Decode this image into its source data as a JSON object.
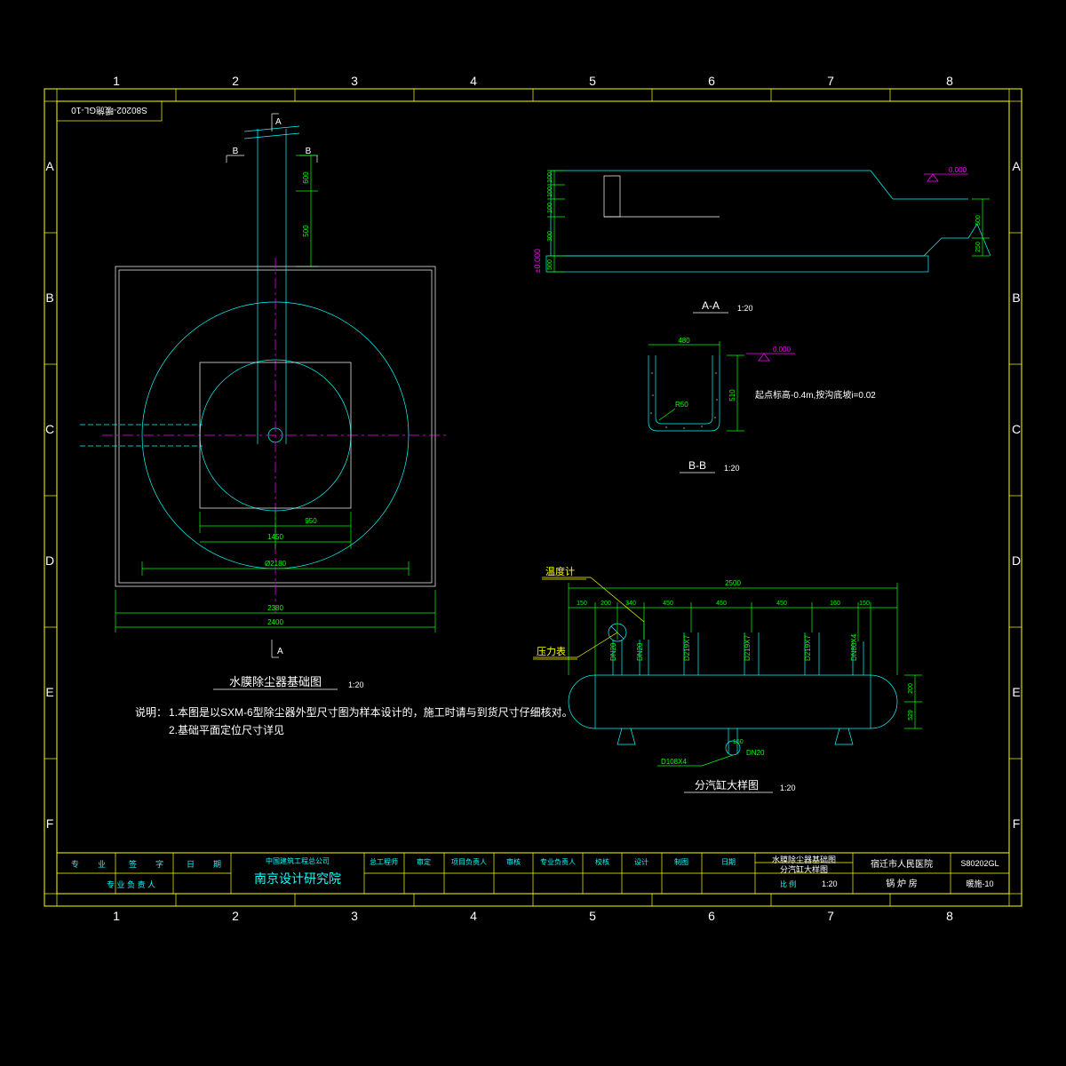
{
  "frame": {
    "drawing_id_top": "S80202-暖施GL-10",
    "cols": [
      "1",
      "2",
      "3",
      "4",
      "5",
      "6",
      "7",
      "8"
    ],
    "rows": [
      "A",
      "B",
      "C",
      "D",
      "E",
      "F"
    ]
  },
  "plan": {
    "title": "水膜除尘器基础图",
    "scale": "1:20",
    "section_labels": {
      "a": "A",
      "b": "B"
    },
    "dims": {
      "d1": "600",
      "d2": "500",
      "inner": "950",
      "mid": "1450",
      "ring": "Ø2180",
      "outer": "2380",
      "outer2": "2400"
    }
  },
  "notes": {
    "prefix": "说明：",
    "l1": "1.本图是以SXM-6型除尘器外型尺寸图为样本设计的，施工时请与到货尺寸仔细核对。",
    "l2": "2.基础平面定位尺寸详见"
  },
  "section_a": {
    "title": "A-A",
    "scale": "1:20",
    "elev0": "0.000",
    "datum": "±0.000",
    "dims": {
      "t1": "100",
      "t2": "100",
      "t3": "100",
      "t4": "300",
      "t5": "500",
      "right1": "500",
      "right2": "250"
    }
  },
  "section_b": {
    "title": "B-B",
    "scale": "1:20",
    "elev": "0.000",
    "note": "起点标高-0.4m,按沟底坡i=0.02",
    "w": "480",
    "h": "510",
    "r": "R50"
  },
  "cylinder": {
    "title": "分汽缸大样图",
    "scale": "1:20",
    "labels": {
      "temp": "温度计",
      "press": "压力表"
    },
    "nozzles": [
      "DN20",
      "DN20",
      "D219X7",
      "D219X7",
      "D219X7",
      "DN80X4"
    ],
    "dims": {
      "total": "2500",
      "seg": [
        "150",
        "200",
        "340",
        "450",
        "450",
        "450",
        "160",
        "150"
      ],
      "h": "200",
      "drain": "D108X4",
      "dn": "DN20",
      "sl": "150",
      "end": "529"
    }
  },
  "titleblock": {
    "institute_small": "中国建筑工程总公司",
    "institute": "南京设计研究院",
    "roles": [
      "总工程师",
      "审定",
      "项目负责人",
      "审核",
      "专业负责人",
      "校核",
      "设计",
      "制图",
      "日期"
    ],
    "left_labels": [
      "专",
      "业",
      "签",
      "字",
      "日",
      "期"
    ],
    "left_row2": "专 业 负 责 人",
    "drawing_title1": "水膜除尘器基础图",
    "drawing_title2": "分汽缸大样图",
    "scale_label": "比 例",
    "scale": "1:20",
    "project": "宿迁市人民医院",
    "subproject": "锅 炉 房",
    "proj_no": "S80202GL",
    "sheet": "暖施-10"
  }
}
